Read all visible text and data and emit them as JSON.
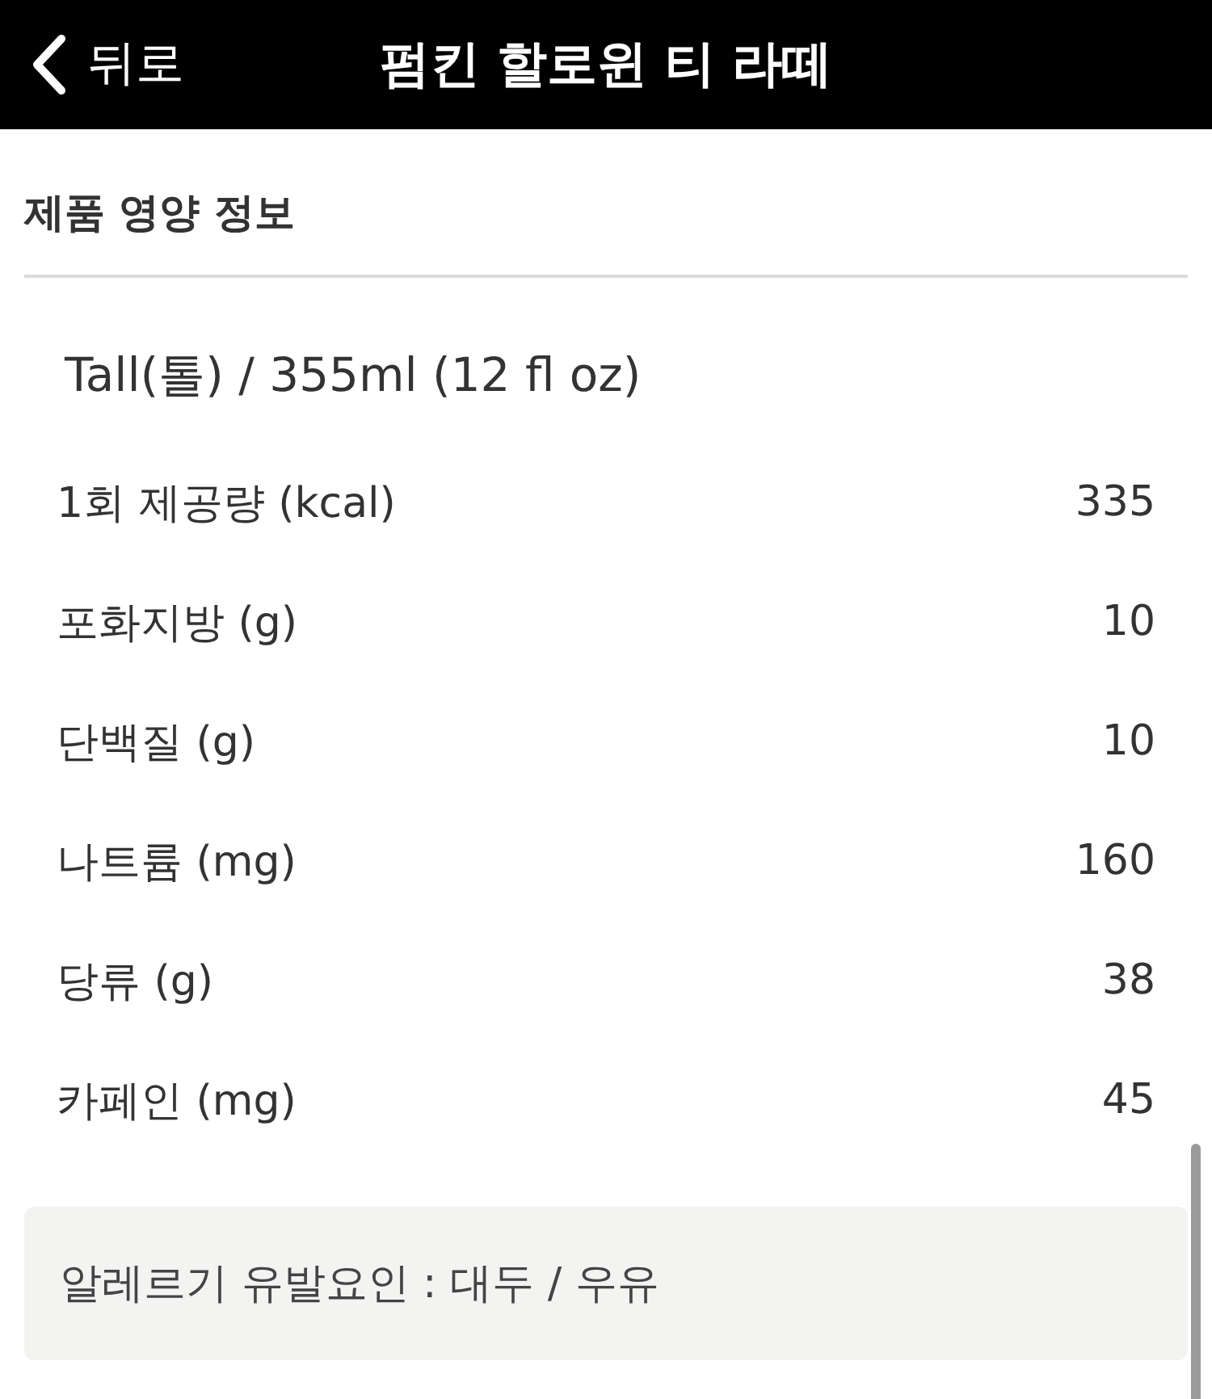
{
  "header": {
    "back_label": "뒤로",
    "title": "펌킨 할로윈 티 라떼"
  },
  "section": {
    "title": "제품 영양 정보"
  },
  "serving_size": "Tall(톨) / 355ml (12 fl oz)",
  "nutrients": [
    {
      "label": "1회 제공량 (kcal)",
      "value": "335"
    },
    {
      "label": "포화지방 (g)",
      "value": "10"
    },
    {
      "label": "단백질 (g)",
      "value": "10"
    },
    {
      "label": "나트륨 (mg)",
      "value": "160"
    },
    {
      "label": "당류 (g)",
      "value": "38"
    },
    {
      "label": "카페인 (mg)",
      "value": "45"
    }
  ],
  "allergy_notice": "알레르기 유발요인 : 대두 / 우유"
}
